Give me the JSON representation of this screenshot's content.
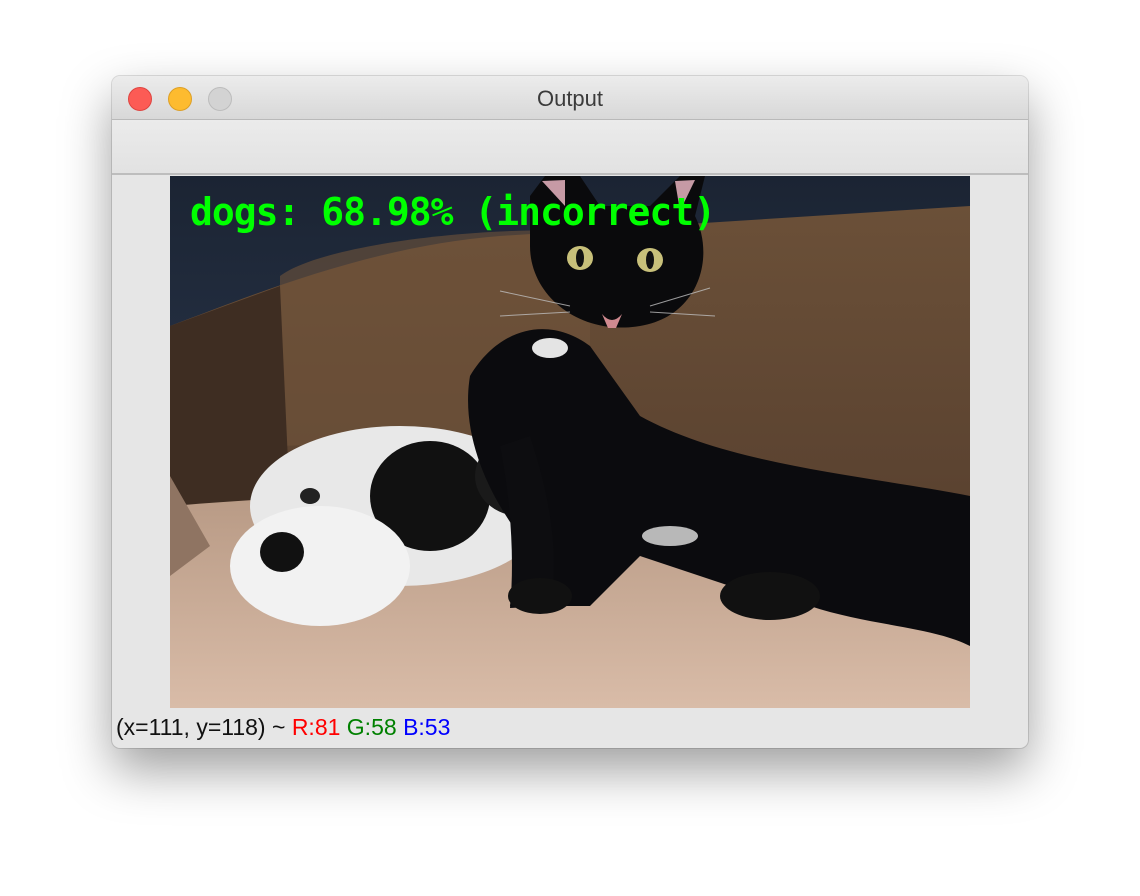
{
  "window": {
    "title": "Output"
  },
  "image": {
    "overlay_text": "dogs: 68.98% (incorrect)",
    "overlay_color": "#00ff00"
  },
  "status": {
    "coords": "(x=111, y=118) ~",
    "r": "R:81",
    "g": "G:58",
    "b": "B:53",
    "r_color": "#ff0000",
    "g_color": "#008000",
    "b_color": "#0000ff"
  }
}
